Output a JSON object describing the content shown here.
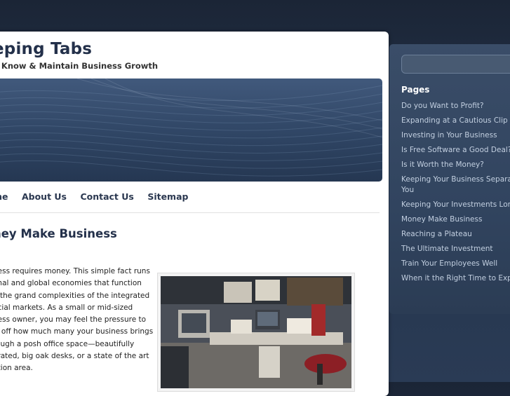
{
  "site": {
    "title": "eping Tabs",
    "tagline": "o Know & Maintain Business Growth"
  },
  "nav": {
    "items": [
      {
        "label": "me"
      },
      {
        "label": "About Us"
      },
      {
        "label": "Contact Us"
      },
      {
        "label": "Sitemap"
      }
    ]
  },
  "post": {
    "title": "ney Make Business",
    "lines": [
      "ness requires money. This simple fact runs",
      "onal and global economies that function",
      "n the grand complexities of the integrated",
      "ncial markets. As a small or mid-sized",
      "ness owner, you may feel the pressure to",
      "w off how much many your business brings",
      "rough a posh office space—beautifully",
      "orated, big oak desks, or a state of the art",
      "ption area."
    ]
  },
  "sidebar": {
    "pages_heading": "Pages",
    "pages": [
      "Do you Want to Profit?",
      "Expanding at a Cautious Clip",
      "Investing in Your Business",
      "Is Free Software a Good Deal?",
      "Is it Worth the Money?",
      "Keeping Your Business Separa From You",
      "Keeping Your Investments Long",
      "Money Make Business",
      "Reaching a Plateau",
      "The Ultimate Investment",
      "Train Your Employees Well",
      "When it the Right Time to Expan"
    ]
  }
}
